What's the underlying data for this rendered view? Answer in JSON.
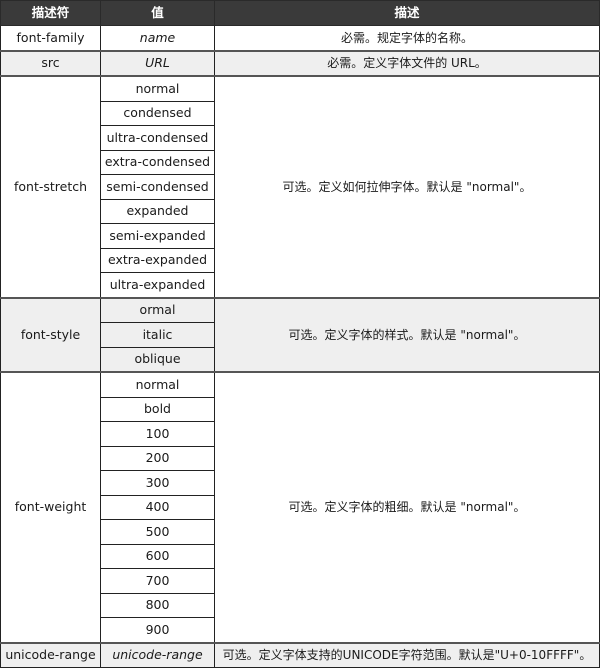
{
  "table": {
    "headers": [
      "描述符",
      "值",
      "描述"
    ],
    "rows": [
      {
        "descriptor": "font-family",
        "values": [
          "name"
        ],
        "values_italic": true,
        "description": "必需。规定字体的名称。"
      },
      {
        "descriptor": "src",
        "values": [
          "URL"
        ],
        "values_italic": true,
        "description": "必需。定义字体文件的 URL。"
      },
      {
        "descriptor": "font-stretch",
        "values": [
          "normal",
          "condensed",
          "ultra-condensed",
          "extra-condensed",
          "semi-condensed",
          "expanded",
          "semi-expanded",
          "extra-expanded",
          "ultra-expanded"
        ],
        "values_italic": false,
        "description": "可选。定义如何拉伸字体。默认是 \"normal\"。"
      },
      {
        "descriptor": "font-style",
        "values": [
          "ormal",
          "italic",
          "oblique"
        ],
        "values_italic": false,
        "description": "可选。定义字体的样式。默认是 \"normal\"。"
      },
      {
        "descriptor": "font-weight",
        "values": [
          "normal",
          "bold",
          "100",
          "200",
          "300",
          "400",
          "500",
          "600",
          "700",
          "800",
          "900"
        ],
        "values_italic": false,
        "description": "可选。定义字体的粗细。默认是 \"normal\"。"
      },
      {
        "descriptor": "unicode-range",
        "values": [
          "unicode-range"
        ],
        "values_italic": true,
        "description": "可选。定义字体支持的UNICODE字符范围。默认是\"U+0-10FFFF\"。"
      }
    ]
  },
  "colors": {
    "header_bg": "#3a3a3a",
    "header_text": "#ffffff",
    "alt_row_bg": "#efefef",
    "border": "#222222"
  }
}
